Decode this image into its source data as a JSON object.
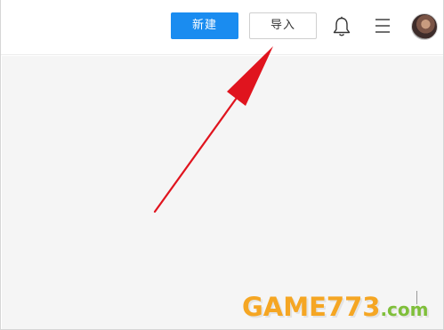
{
  "toolbar": {
    "new_button_label": "新建",
    "import_button_label": "导入"
  },
  "icons": {
    "notification": "bell-icon",
    "menu": "hamburger-menu-icon",
    "avatar": "user-avatar"
  },
  "annotation": {
    "arrow_color": "#e0141e"
  },
  "watermark": {
    "main_text": "GAME773",
    "suffix_text": ".com"
  },
  "colors": {
    "primary_button": "#1a8cf0",
    "content_background": "#f5f5f5"
  }
}
